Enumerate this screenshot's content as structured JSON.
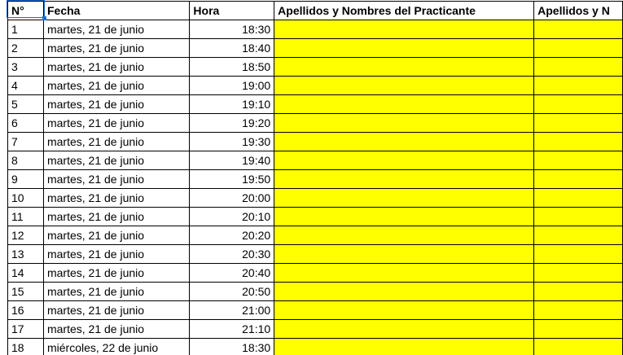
{
  "headers": {
    "n": "N°",
    "fecha": "Fecha",
    "hora": "Hora",
    "practicante": "Apellidos y Nombres del Practicante",
    "next": "Apellidos y N"
  },
  "rows": [
    {
      "n": "1",
      "fecha": "martes, 21 de junio",
      "hora": "18:30"
    },
    {
      "n": "2",
      "fecha": "martes, 21 de junio",
      "hora": "18:40"
    },
    {
      "n": "3",
      "fecha": "martes, 21 de junio",
      "hora": "18:50"
    },
    {
      "n": "4",
      "fecha": "martes, 21 de junio",
      "hora": "19:00"
    },
    {
      "n": "5",
      "fecha": "martes, 21 de junio",
      "hora": "19:10"
    },
    {
      "n": "6",
      "fecha": "martes, 21 de junio",
      "hora": "19:20"
    },
    {
      "n": "7",
      "fecha": "martes, 21 de junio",
      "hora": "19:30"
    },
    {
      "n": "8",
      "fecha": "martes, 21 de junio",
      "hora": "19:40"
    },
    {
      "n": "9",
      "fecha": "martes, 21 de junio",
      "hora": "19:50"
    },
    {
      "n": "10",
      "fecha": "martes, 21 de junio",
      "hora": "20:00"
    },
    {
      "n": "11",
      "fecha": "martes, 21 de junio",
      "hora": "20:10"
    },
    {
      "n": "12",
      "fecha": "martes, 21 de junio",
      "hora": "20:20"
    },
    {
      "n": "13",
      "fecha": "martes, 21 de junio",
      "hora": "20:30"
    },
    {
      "n": "14",
      "fecha": "martes, 21 de junio",
      "hora": "20:40"
    },
    {
      "n": "15",
      "fecha": "martes, 21 de junio",
      "hora": "20:50"
    },
    {
      "n": "16",
      "fecha": "martes, 21 de junio",
      "hora": "21:00"
    },
    {
      "n": "17",
      "fecha": "martes, 21 de junio",
      "hora": "21:10"
    },
    {
      "n": "18",
      "fecha": "miércoles, 22 de junio",
      "hora": "18:30"
    }
  ],
  "colors": {
    "fill": "#ffff00",
    "selection": "#1f6fd1",
    "border": "#000000"
  }
}
